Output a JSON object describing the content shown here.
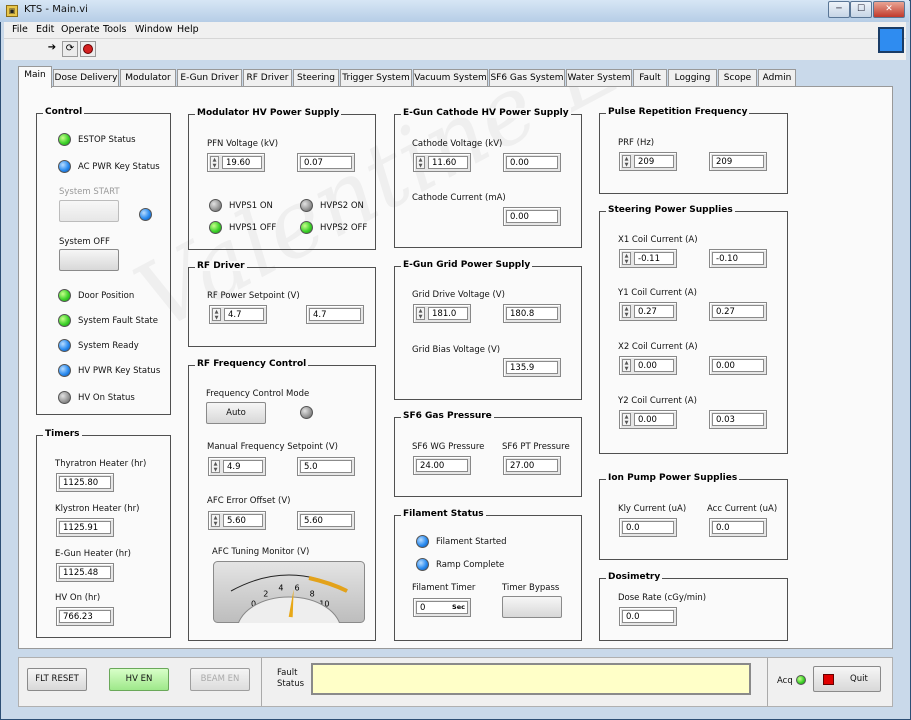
{
  "window": {
    "title": "KTS - Main.vi",
    "menu": [
      "File",
      "Edit",
      "Operate",
      "Tools",
      "Window",
      "Help"
    ]
  },
  "colors": {
    "led_green": "#3ed22b",
    "led_blue": "#2b8cf0",
    "led_gray": "#9a9a9a",
    "fault_bg": "#ffffc8",
    "quit_red": "#e00000"
  },
  "tabs": [
    "Main",
    "Dose Delivery",
    "Modulator",
    "E-Gun Driver",
    "RF Driver",
    "Steering",
    "Trigger System",
    "Vacuum System",
    "SF6 Gas System",
    "Water System",
    "Fault",
    "Logging",
    "Scope",
    "Admin"
  ],
  "watermark": "Valentine Engineering",
  "control": {
    "title": "Control",
    "estop": "ESTOP Status",
    "ac_key": "AC PWR Key Status",
    "system_start": "System START",
    "system_off": "System OFF",
    "door": "Door Position",
    "fault_state": "System Fault State",
    "ready": "System Ready",
    "hv_key": "HV PWR Key Status",
    "hv_on": "HV On Status"
  },
  "timers": {
    "title": "Timers",
    "thyratron_label": "Thyratron Heater (hr)",
    "thyratron": "1125.80",
    "klystron_label": "Klystron Heater (hr)",
    "klystron": "1125.91",
    "egun_label": "E-Gun Heater (hr)",
    "egun": "1125.48",
    "hv_label": "HV On (hr)",
    "hv": "766.23"
  },
  "modulator": {
    "title": "Modulator HV Power Supply",
    "pfn_label": "PFN Voltage (kV)",
    "pfn_set": "19.60",
    "pfn_read": "0.07",
    "hvps1_on": "HVPS1 ON",
    "hvps2_on": "HVPS2 ON",
    "hvps1_off": "HVPS1 OFF",
    "hvps2_off": "HVPS2 OFF"
  },
  "rf_driver": {
    "title": "RF Driver",
    "setpoint_label": "RF Power Setpoint (V)",
    "setpoint": "4.7",
    "read": "4.7"
  },
  "rf_freq": {
    "title": "RF Frequency Control",
    "mode_label": "Frequency Control Mode",
    "mode": "Auto",
    "manual_label": "Manual Frequency Setpoint (V)",
    "manual_set": "4.9",
    "manual_read": "5.0",
    "afc_label": "AFC Error Offset (V)",
    "afc_set": "5.60",
    "afc_read": "5.60",
    "monitor_label": "AFC Tuning Monitor (V)",
    "gauge_ticks": [
      "0",
      "2",
      "4",
      "6",
      "8",
      "10"
    ],
    "gauge_value": 5.6
  },
  "egun_hv": {
    "title": "E-Gun Cathode HV Power Supply",
    "cathode_v_label": "Cathode Voltage (kV)",
    "cathode_v_set": "11.60",
    "cathode_v_read": "0.00",
    "cathode_i_label": "Cathode Current (mA)",
    "cathode_i": "0.00"
  },
  "egun_grid": {
    "title": "E-Gun Grid Power Supply",
    "drive_label": "Grid Drive Voltage (V)",
    "drive_set": "181.0",
    "drive_read": "180.8",
    "bias_label": "Grid Bias Voltage (V)",
    "bias": "135.9"
  },
  "sf6": {
    "title": "SF6 Gas Pressure",
    "wg_label": "SF6 WG Pressure",
    "wg": "24.00",
    "pt_label": "SF6 PT Pressure",
    "pt": "27.00"
  },
  "filament": {
    "title": "Filament Status",
    "started": "Filament Started",
    "ramp": "Ramp Complete",
    "timer_label": "Filament Timer",
    "timer": "0",
    "timer_unit": "Sec",
    "bypass_label": "Timer Bypass"
  },
  "prf": {
    "title": "Pulse Repetition Frequency",
    "label": "PRF (Hz)",
    "set": "209",
    "read": "209"
  },
  "steering": {
    "title": "Steering Power Supplies",
    "x1_label": "X1 Coil Current (A)",
    "x1_set": "-0.11",
    "x1_read": "-0.10",
    "y1_label": "Y1 Coil Current (A)",
    "y1_set": "0.27",
    "y1_read": "0.27",
    "x2_label": "X2 Coil Current (A)",
    "x2_set": "0.00",
    "x2_read": "0.00",
    "y2_label": "Y2 Coil Current (A)",
    "y2_set": "0.00",
    "y2_read": "0.03"
  },
  "ion_pump": {
    "title": "Ion Pump Power Supplies",
    "kly_label": "Kly Current (uA)",
    "kly": "0.0",
    "acc_label": "Acc Current (uA)",
    "acc": "0.0"
  },
  "dosimetry": {
    "title": "Dosimetry",
    "rate_label": "Dose Rate (cGy/min)",
    "rate": "0.0"
  },
  "bottom": {
    "flt_reset": "FLT RESET",
    "hv_en": "HV EN",
    "beam_en": "BEAM EN",
    "fault_label": "Fault Status",
    "fault_text": "",
    "acq_label": "Acq",
    "quit_label": "Quit"
  }
}
